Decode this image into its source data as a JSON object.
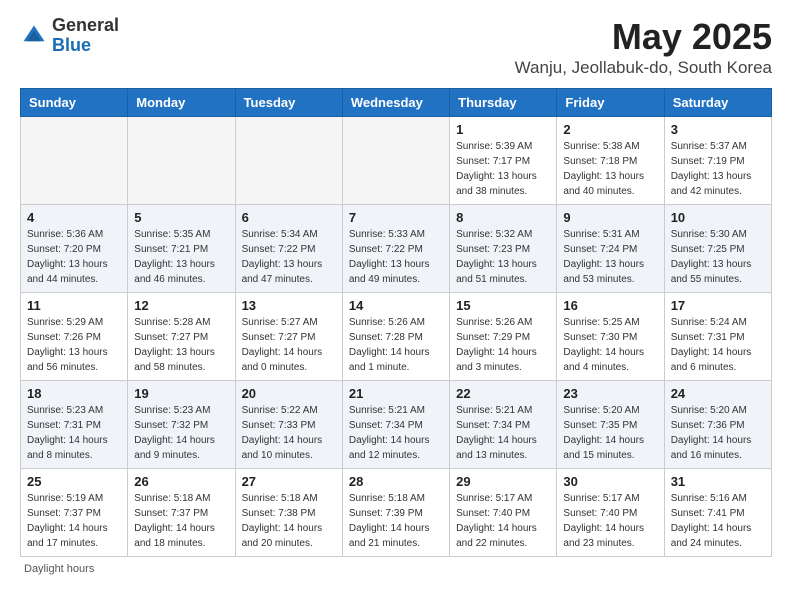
{
  "header": {
    "logo_general": "General",
    "logo_blue": "Blue",
    "month_title": "May 2025",
    "location": "Wanju, Jeollabuk-do, South Korea"
  },
  "weekdays": [
    "Sunday",
    "Monday",
    "Tuesday",
    "Wednesday",
    "Thursday",
    "Friday",
    "Saturday"
  ],
  "weeks": [
    [
      {
        "day": "",
        "info": ""
      },
      {
        "day": "",
        "info": ""
      },
      {
        "day": "",
        "info": ""
      },
      {
        "day": "",
        "info": ""
      },
      {
        "day": "1",
        "info": "Sunrise: 5:39 AM\nSunset: 7:17 PM\nDaylight: 13 hours\nand 38 minutes."
      },
      {
        "day": "2",
        "info": "Sunrise: 5:38 AM\nSunset: 7:18 PM\nDaylight: 13 hours\nand 40 minutes."
      },
      {
        "day": "3",
        "info": "Sunrise: 5:37 AM\nSunset: 7:19 PM\nDaylight: 13 hours\nand 42 minutes."
      }
    ],
    [
      {
        "day": "4",
        "info": "Sunrise: 5:36 AM\nSunset: 7:20 PM\nDaylight: 13 hours\nand 44 minutes."
      },
      {
        "day": "5",
        "info": "Sunrise: 5:35 AM\nSunset: 7:21 PM\nDaylight: 13 hours\nand 46 minutes."
      },
      {
        "day": "6",
        "info": "Sunrise: 5:34 AM\nSunset: 7:22 PM\nDaylight: 13 hours\nand 47 minutes."
      },
      {
        "day": "7",
        "info": "Sunrise: 5:33 AM\nSunset: 7:22 PM\nDaylight: 13 hours\nand 49 minutes."
      },
      {
        "day": "8",
        "info": "Sunrise: 5:32 AM\nSunset: 7:23 PM\nDaylight: 13 hours\nand 51 minutes."
      },
      {
        "day": "9",
        "info": "Sunrise: 5:31 AM\nSunset: 7:24 PM\nDaylight: 13 hours\nand 53 minutes."
      },
      {
        "day": "10",
        "info": "Sunrise: 5:30 AM\nSunset: 7:25 PM\nDaylight: 13 hours\nand 55 minutes."
      }
    ],
    [
      {
        "day": "11",
        "info": "Sunrise: 5:29 AM\nSunset: 7:26 PM\nDaylight: 13 hours\nand 56 minutes."
      },
      {
        "day": "12",
        "info": "Sunrise: 5:28 AM\nSunset: 7:27 PM\nDaylight: 13 hours\nand 58 minutes."
      },
      {
        "day": "13",
        "info": "Sunrise: 5:27 AM\nSunset: 7:27 PM\nDaylight: 14 hours\nand 0 minutes."
      },
      {
        "day": "14",
        "info": "Sunrise: 5:26 AM\nSunset: 7:28 PM\nDaylight: 14 hours\nand 1 minute."
      },
      {
        "day": "15",
        "info": "Sunrise: 5:26 AM\nSunset: 7:29 PM\nDaylight: 14 hours\nand 3 minutes."
      },
      {
        "day": "16",
        "info": "Sunrise: 5:25 AM\nSunset: 7:30 PM\nDaylight: 14 hours\nand 4 minutes."
      },
      {
        "day": "17",
        "info": "Sunrise: 5:24 AM\nSunset: 7:31 PM\nDaylight: 14 hours\nand 6 minutes."
      }
    ],
    [
      {
        "day": "18",
        "info": "Sunrise: 5:23 AM\nSunset: 7:31 PM\nDaylight: 14 hours\nand 8 minutes."
      },
      {
        "day": "19",
        "info": "Sunrise: 5:23 AM\nSunset: 7:32 PM\nDaylight: 14 hours\nand 9 minutes."
      },
      {
        "day": "20",
        "info": "Sunrise: 5:22 AM\nSunset: 7:33 PM\nDaylight: 14 hours\nand 10 minutes."
      },
      {
        "day": "21",
        "info": "Sunrise: 5:21 AM\nSunset: 7:34 PM\nDaylight: 14 hours\nand 12 minutes."
      },
      {
        "day": "22",
        "info": "Sunrise: 5:21 AM\nSunset: 7:34 PM\nDaylight: 14 hours\nand 13 minutes."
      },
      {
        "day": "23",
        "info": "Sunrise: 5:20 AM\nSunset: 7:35 PM\nDaylight: 14 hours\nand 15 minutes."
      },
      {
        "day": "24",
        "info": "Sunrise: 5:20 AM\nSunset: 7:36 PM\nDaylight: 14 hours\nand 16 minutes."
      }
    ],
    [
      {
        "day": "25",
        "info": "Sunrise: 5:19 AM\nSunset: 7:37 PM\nDaylight: 14 hours\nand 17 minutes."
      },
      {
        "day": "26",
        "info": "Sunrise: 5:18 AM\nSunset: 7:37 PM\nDaylight: 14 hours\nand 18 minutes."
      },
      {
        "day": "27",
        "info": "Sunrise: 5:18 AM\nSunset: 7:38 PM\nDaylight: 14 hours\nand 20 minutes."
      },
      {
        "day": "28",
        "info": "Sunrise: 5:18 AM\nSunset: 7:39 PM\nDaylight: 14 hours\nand 21 minutes."
      },
      {
        "day": "29",
        "info": "Sunrise: 5:17 AM\nSunset: 7:40 PM\nDaylight: 14 hours\nand 22 minutes."
      },
      {
        "day": "30",
        "info": "Sunrise: 5:17 AM\nSunset: 7:40 PM\nDaylight: 14 hours\nand 23 minutes."
      },
      {
        "day": "31",
        "info": "Sunrise: 5:16 AM\nSunset: 7:41 PM\nDaylight: 14 hours\nand 24 minutes."
      }
    ]
  ],
  "footer": {
    "daylight_hours_label": "Daylight hours"
  }
}
